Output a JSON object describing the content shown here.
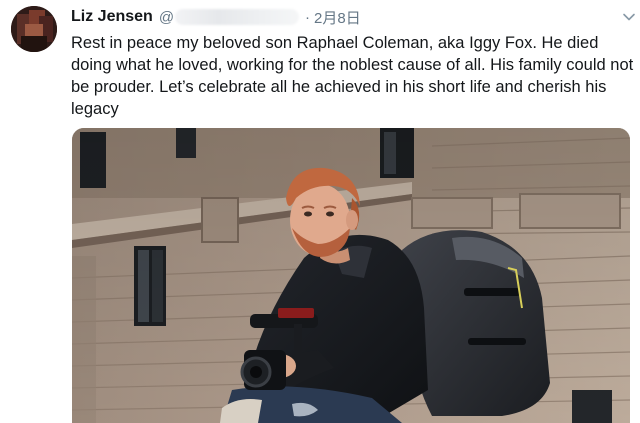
{
  "tweet": {
    "display_name": "Liz Jensen",
    "handle_prefix": "@",
    "separator": "·",
    "timestamp": "2月8日",
    "text": "Rest in peace my beloved son Raphael Coleman, aka Iggy Fox. He died doing what he loved, working for the noblest cause of all. His family could not be prouder. Let’s celebrate all he achieved in his short life and cherish his legacy",
    "caret_icon": "chevron-down-icon",
    "avatar_icon": "profile-avatar",
    "photo_description_icon": "attached-photo"
  },
  "colors": {
    "text_primary": "#14171a",
    "text_secondary": "#657786",
    "background": "#ffffff"
  }
}
